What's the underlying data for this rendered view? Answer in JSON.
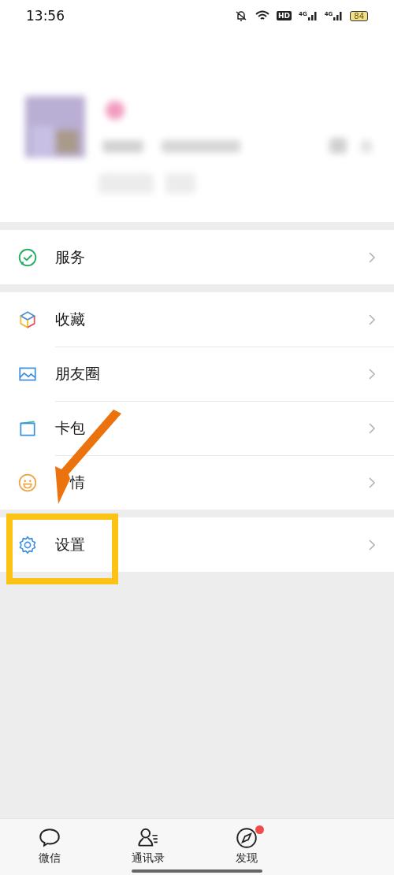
{
  "status_bar": {
    "time": "13:56",
    "hd": "HD",
    "networks": [
      "4G",
      "4G"
    ],
    "battery": "84"
  },
  "groups": [
    {
      "items": [
        {
          "label": "服务",
          "kind": "service"
        }
      ]
    },
    {
      "items": [
        {
          "label": "收藏",
          "kind": "favorites"
        },
        {
          "label": "朋友圈",
          "kind": "moments"
        },
        {
          "label": "卡包",
          "kind": "cards"
        },
        {
          "label": "情",
          "kind": "stickers",
          "partly_covered": true
        }
      ]
    },
    {
      "items": [
        {
          "label": "设置",
          "kind": "settings"
        }
      ]
    }
  ],
  "tab_bar": [
    {
      "label": "微信",
      "kind": "chats",
      "dot": false
    },
    {
      "label": "通讯录",
      "kind": "contacts",
      "dot": false
    },
    {
      "label": "发现",
      "kind": "discover",
      "dot": true
    }
  ]
}
